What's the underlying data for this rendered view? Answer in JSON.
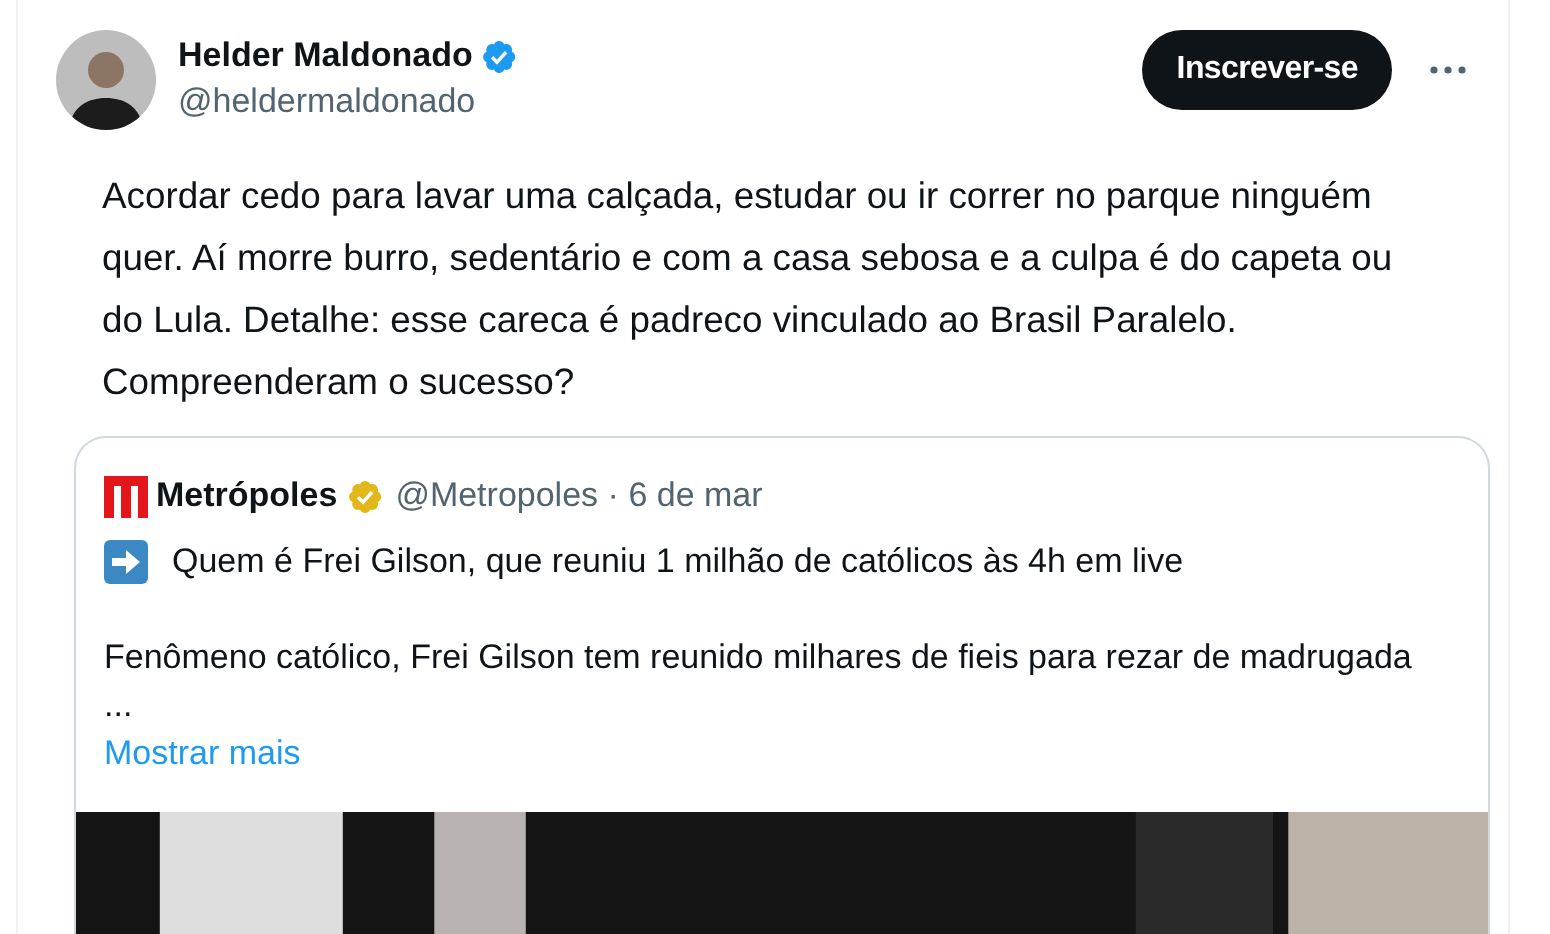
{
  "author": {
    "name": "Helder Maldonado",
    "verified": true,
    "handle": "@heldermaldonado"
  },
  "follow_button": "Inscrever-se",
  "tweet_text": "Acordar cedo para lavar uma calçada, estudar ou ir correr no parque ninguém quer. Aí morre burro, sedentário e com a casa sebosa e a culpa é do capeta ou do Lula. Detalhe: esse careca é padreco vinculado ao Brasil Paralelo. Compreenderam o sucesso?",
  "quoted": {
    "name": "Metrópoles",
    "verified": true,
    "handle": "@Metropoles",
    "separator": "·",
    "date": "6 de mar",
    "headline": "Quem é Frei Gilson, que reuniu 1 milhão de católicos às 4h em live",
    "summary": "Fenômeno católico, Frei Gilson tem reunido milhares de fieis para rezar de madrugada",
    "ellipsis": "...",
    "show_more": "Mostrar mais"
  }
}
